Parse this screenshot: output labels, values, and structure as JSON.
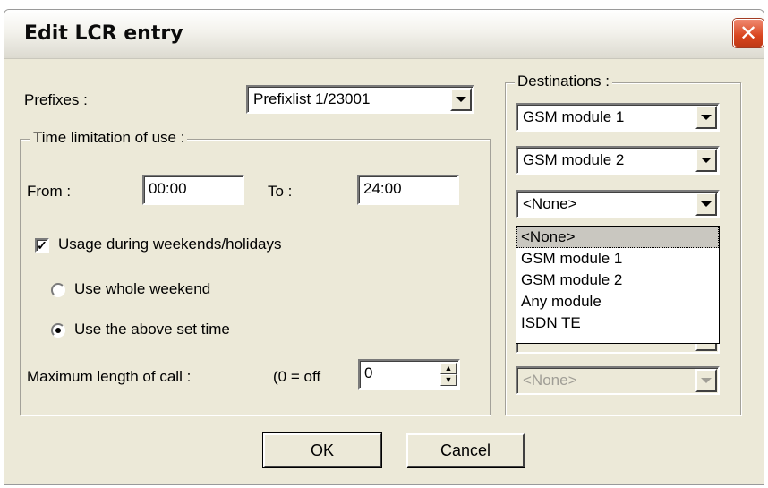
{
  "window": {
    "title": "Edit LCR entry",
    "close_symbol": "✕"
  },
  "prefixes": {
    "label": "Prefixes :",
    "value": "Prefixlist 1/23001"
  },
  "time_group": {
    "legend": "Time limitation of use :",
    "from_label": "From :",
    "from_value": "00:00",
    "to_label": "To :",
    "to_value": "24:00",
    "weekend_checkbox": {
      "label": "Usage during weekends/holidays",
      "checked": true,
      "mark": "✓"
    },
    "radio_whole": {
      "label": "Use whole weekend",
      "selected": false
    },
    "radio_above": {
      "label": "Use the above set time",
      "selected": true
    },
    "max_length_label": "Maximum length of call :",
    "max_length_hint": "(0 = off",
    "max_length_value": "0"
  },
  "destinations": {
    "legend": "Destinations :",
    "combo1": "GSM module 1",
    "combo2": "GSM module 2",
    "combo3": "<None>",
    "combo_last": "<None>",
    "dropdown_options": [
      "<None>",
      "GSM module 1",
      "GSM module 2",
      "Any module",
      "ISDN TE"
    ],
    "dropdown_selected_index": 0
  },
  "buttons": {
    "ok": "OK",
    "cancel": "Cancel"
  },
  "icons": {
    "dropdown_arrow": "chevron-down-icon",
    "close": "close-icon",
    "check": "check-icon",
    "spin_up": "arrow-up-icon",
    "spin_down": "arrow-down-icon"
  },
  "colors": {
    "dialog_bg": "#ece9d8",
    "close_button": "#d9451f"
  }
}
